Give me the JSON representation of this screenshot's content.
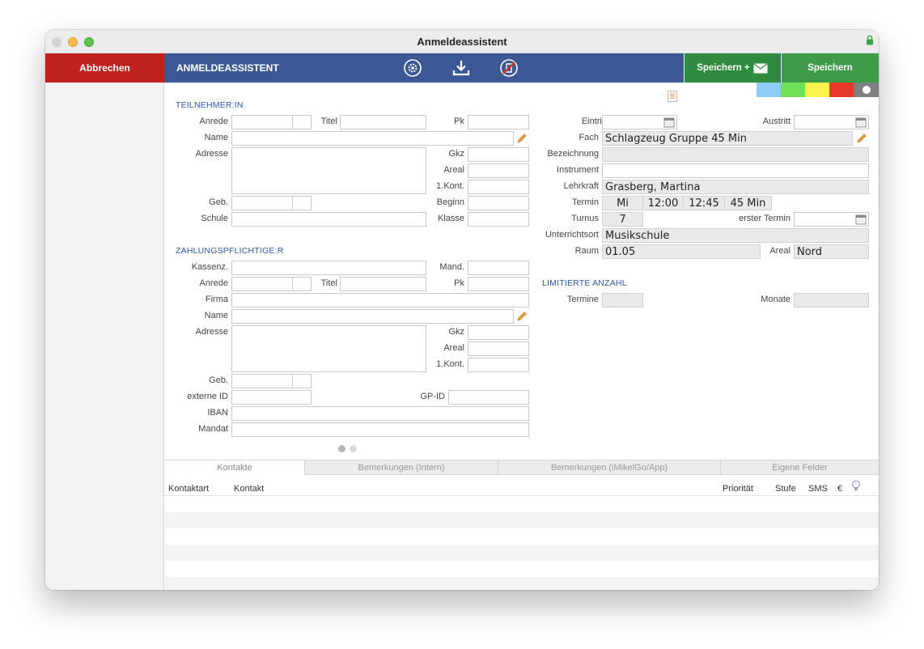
{
  "window": {
    "title": "Anmeldeassistent"
  },
  "toolbar": {
    "cancel_label": "Abbrechen",
    "title": "ANMELDEASSISTENT",
    "save_mail_label": "Speichern +",
    "save_label": "Speichern",
    "icons": [
      "settings-icon",
      "download-icon",
      "no-sync-icon",
      "mail-icon"
    ]
  },
  "color_swatches": [
    "#8ecdf5",
    "#6fe25a",
    "#fbf24a",
    "#e8372b",
    "#7f7f7f"
  ],
  "participant": {
    "section_title": "TEILNEHMER:IN",
    "labels": {
      "anrede": "Anrede",
      "titel": "Titel",
      "pk": "Pk",
      "name": "Name",
      "adresse": "Adresse",
      "gkz": "Gkz",
      "areal": "Areal",
      "kont": "1.Kont.",
      "geb": "Geb.",
      "beginn": "Beginn",
      "schule": "Schule",
      "klasse": "Klasse"
    }
  },
  "payer": {
    "section_title": "ZAHLUNGSPFLICHTIGE:R",
    "labels": {
      "kassenz": "Kassenz.",
      "mand": "Mand.",
      "anrede": "Anrede",
      "titel": "Titel",
      "pk": "Pk",
      "firma": "Firma",
      "name": "Name",
      "adresse": "Adresse",
      "gkz": "Gkz",
      "areal": "Areal",
      "kont": "1.Kont.",
      "geb": "Geb.",
      "externe_id": "externe ID",
      "gp_id": "GP-ID",
      "iban": "IBAN",
      "mandat": "Mandat"
    }
  },
  "course": {
    "labels": {
      "eintritt": "Eintritt",
      "austritt": "Austritt",
      "fach": "Fach",
      "bezeichnung": "Bezeichnung",
      "instrument": "Instrument",
      "lehrkraft": "Lehrkraft",
      "termin": "Termin",
      "turnus": "Turnus",
      "erster_termin": "erster Termin",
      "unterrichtsort": "Unterrichtsort",
      "raum": "Raum",
      "areal": "Areal"
    },
    "values": {
      "fach": "Schlagzeug Gruppe 45 Min",
      "lehrkraft": "Grasberg, Martina",
      "termin_day": "Mi",
      "termin_start": "12:00",
      "termin_end": "12:45",
      "termin_duration": "45 Min",
      "turnus": "7",
      "unterrichtsort": "Musikschule",
      "raum": "01.05",
      "areal": "Nord"
    }
  },
  "limited": {
    "section_title": "LIMITIERTE ANZAHL",
    "termine_label": "Termine",
    "monate_label": "Monate"
  },
  "tabs": [
    "Kontakte",
    "Bemerkungen (Intern)",
    "Bemerkungen (iMikelGo/App)",
    "Eigene Felder"
  ],
  "contacts_table": {
    "columns": [
      "Kontaktart",
      "Kontakt",
      "Priorität",
      "Stufe",
      "SMS",
      "€"
    ]
  }
}
